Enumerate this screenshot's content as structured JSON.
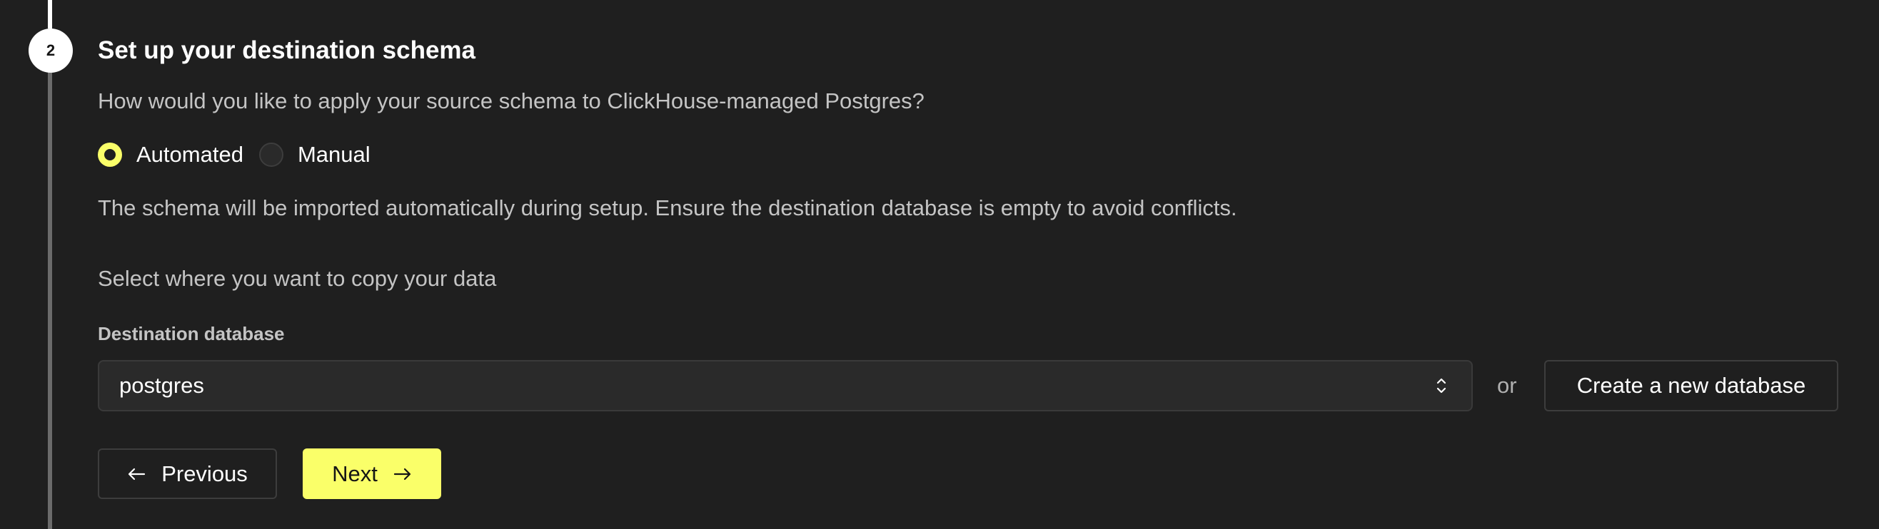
{
  "step": {
    "number": "2",
    "title": "Set up your destination schema"
  },
  "question": "How would you like to apply your source schema to ClickHouse-managed Postgres?",
  "schema_mode": {
    "options": [
      {
        "label": "Automated",
        "selected": true
      },
      {
        "label": "Manual",
        "selected": false
      }
    ]
  },
  "description": "The schema will be imported automatically during setup. Ensure the destination database is empty to avoid conflicts.",
  "copy_prompt": "Select where you want to copy your data",
  "destination": {
    "label": "Destination database",
    "value": "postgres",
    "or_text": "or",
    "create_label": "Create a new database"
  },
  "nav": {
    "previous_label": "Previous",
    "next_label": "Next"
  },
  "colors": {
    "accent": "#faff69",
    "background": "#1f1f1f"
  }
}
